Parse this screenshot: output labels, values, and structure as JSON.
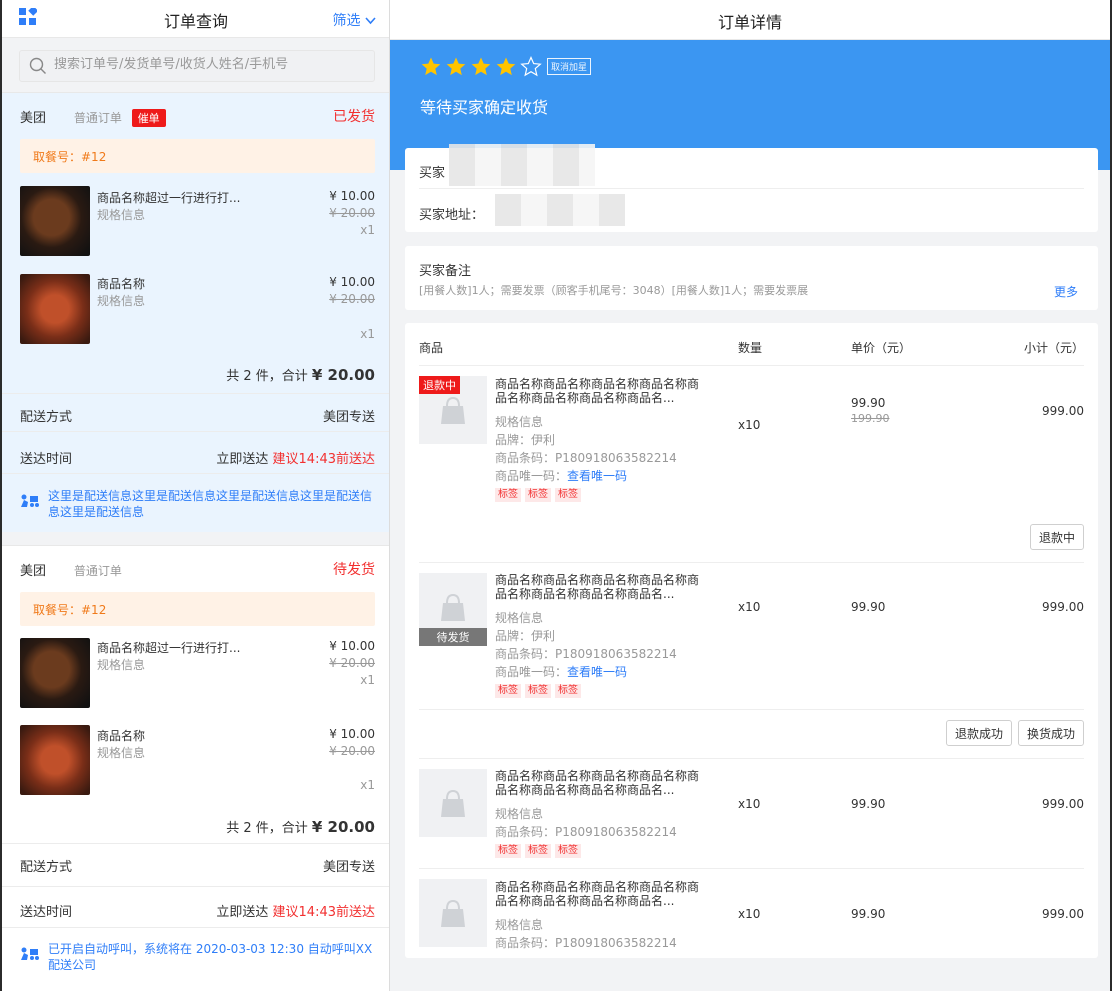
{
  "left": {
    "title": "订单查询",
    "filter_label": "筛选",
    "search_placeholder": "搜索订单号/发货单号/收货人姓名/手机号",
    "orders": [
      {
        "shop": "美团",
        "type": "普通订单",
        "urge": "催单",
        "status": "已发货",
        "pickup": "取餐号：#12",
        "items": [
          {
            "name": "商品名称超过一行进行打...",
            "spec": "规格信息",
            "price": "¥ 10.00",
            "orig_price": "¥ 20.00",
            "qty": "x1"
          },
          {
            "name": "商品名称",
            "spec": "规格信息",
            "price": "¥ 10.00",
            "orig_price": "¥ 20.00",
            "qty": "x1"
          }
        ],
        "total_prefix": "共 2 件，合计",
        "total_amount": "¥ 20.00",
        "delivery_method_label": "配送方式",
        "delivery_method": "美团专送",
        "delivery_time_label": "送达时间",
        "delivery_time": "立即送达",
        "delivery_hint": "建议14:43前送达",
        "delivery_info": "这里是配送信息这里是配送信息这里是配送信息这里是配送信息这里是配送信息"
      },
      {
        "shop": "美团",
        "type": "普通订单",
        "status": "待发货",
        "pickup": "取餐号：#12",
        "items": [
          {
            "name": "商品名称超过一行进行打...",
            "spec": "规格信息",
            "price": "¥ 10.00",
            "orig_price": "¥ 20.00",
            "qty": "x1"
          },
          {
            "name": "商品名称",
            "spec": "规格信息",
            "price": "¥ 10.00",
            "orig_price": "¥ 20.00",
            "qty": "x1"
          }
        ],
        "total_prefix": "共 2 件，合计",
        "total_amount": "¥ 20.00",
        "delivery_method_label": "配送方式",
        "delivery_method": "美团专送",
        "delivery_time_label": "送达时间",
        "delivery_time": "立即送达",
        "delivery_hint": "建议14:43前送达",
        "delivery_info": "已开启自动呼叫，系统将在 2020-03-03 12:30 自动呼叫XX配送公司"
      }
    ]
  },
  "right": {
    "title": "订单详情",
    "rating_stars": 4,
    "unstar_label": "取消加星",
    "status_text": "等待买家确定收货",
    "buyer_label": "买家",
    "buyer_address_label": "买家地址：",
    "remark_title": "买家备注",
    "remark_text": "[用餐人数]1人；需要发票（顾客手机尾号：3048）[用餐人数]1人；需要发票展",
    "more_label": "更多",
    "table_headers": {
      "product": "商品",
      "qty": "数量",
      "unit_price": "单价（元）",
      "subtotal": "小计（元）"
    },
    "products": [
      {
        "badge": "退款中",
        "title": "商品名称商品名称商品名称商品名称商品名称商品名称商品名称商品名...",
        "spec": "规格信息",
        "brand": "品牌：伊利",
        "barcode": "商品条码：P180918063582214",
        "unique_label": "商品唯一码：",
        "unique_link": "查看唯一码",
        "tags": [
          "标签",
          "标签",
          "标签"
        ],
        "qty": "x10",
        "price": "99.90",
        "orig_price": "199.90",
        "subtotal": "999.00",
        "buttons": [
          "退款中"
        ]
      },
      {
        "badge": "待发货",
        "title": "商品名称商品名称商品名称商品名称商品名称商品名称商品名称商品名...",
        "spec": "规格信息",
        "brand": "品牌：伊利",
        "barcode": "商品条码：P180918063582214",
        "unique_label": "商品唯一码：",
        "unique_link": "查看唯一码",
        "tags": [
          "标签",
          "标签",
          "标签"
        ],
        "qty": "x10",
        "price": "99.90",
        "subtotal": "999.00",
        "buttons": [
          "退款成功",
          "换货成功"
        ]
      },
      {
        "title": "商品名称商品名称商品名称商品名称商品名称商品名称商品名称商品名...",
        "spec": "规格信息",
        "barcode": "商品条码：P180918063582214",
        "tags": [
          "标签",
          "标签",
          "标签"
        ],
        "qty": "x10",
        "price": "99.90",
        "subtotal": "999.00"
      },
      {
        "title": "商品名称商品名称商品名称商品名称商品名称商品名称商品名称商品名...",
        "spec": "规格信息",
        "barcode": "商品条码：P180918063582214",
        "qty": "x10",
        "price": "99.90",
        "subtotal": "999.00"
      }
    ]
  },
  "colors": {
    "accent": "#2f7ef8",
    "banner": "#3b96f2",
    "danger": "#f23030",
    "pickup_bg": "#fff2e6",
    "pickup_text": "#f07a1a",
    "star": "#ffc400"
  },
  "icons": [
    "grid-icon",
    "chevron-down-icon",
    "search-icon",
    "star-icon",
    "star-outline-icon",
    "delivery-rider-icon",
    "bag-placeholder-icon"
  ]
}
